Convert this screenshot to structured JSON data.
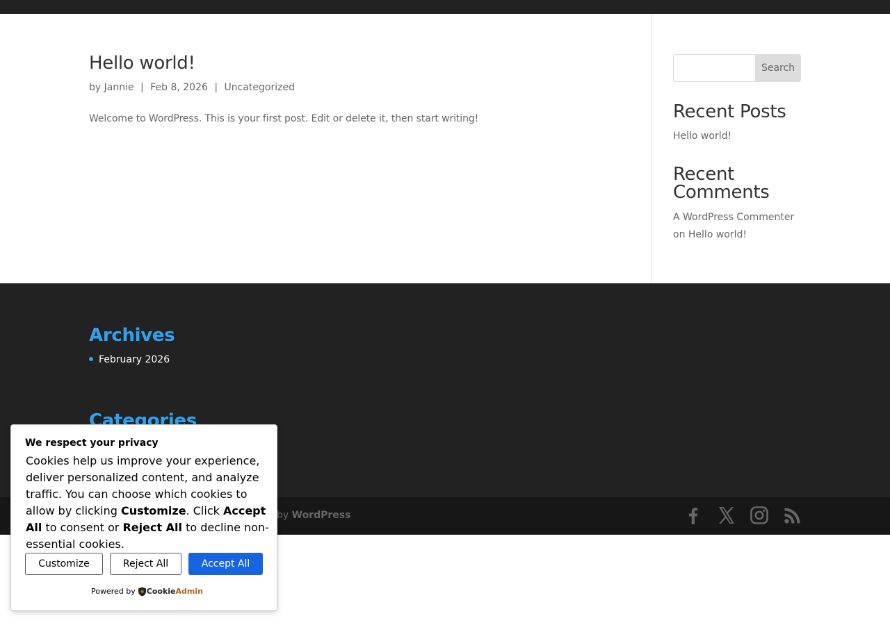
{
  "post": {
    "title": "Hello world!",
    "meta_by": "by",
    "author": "Jannie",
    "sep": "|",
    "date": "Feb 8, 2026",
    "category": "Uncategorized",
    "excerpt": "Welcome to WordPress. This is your first post. Edit or delete it, then start writing!"
  },
  "sidebar": {
    "search_placeholder": "",
    "search_button": "Search",
    "recent_posts_title": "Recent Posts",
    "recent_posts": [
      "Hello world!"
    ],
    "recent_comments_title_line1": "Recent",
    "recent_comments_title_line2": "Comments",
    "comment_author": "A WordPress Commenter",
    "comment_on": "on",
    "comment_post": "Hello world!"
  },
  "footer": {
    "archives_title": "Archives",
    "archives": [
      "February 2026"
    ],
    "categories_title": "Categories",
    "credit_prefix": "by",
    "credit_link": "WordPress",
    "social_icons": [
      "facebook-icon",
      "x-icon",
      "instagram-icon",
      "rss-icon"
    ]
  },
  "cookie_banner": {
    "title": "We respect your privacy",
    "text_1": "Cookies help us improve your experience, deliver personalized content, and analyze traffic. You can choose which cookies to allow by clicking ",
    "bold_customize": "Customize",
    "text_2": ". Click ",
    "bold_accept": "Accept All",
    "text_3": " to consent or ",
    "bold_reject": "Reject All",
    "text_4": " to decline non-essential cookies.",
    "customize_button": "Customize",
    "reject_button": "Reject All",
    "accept_button": "Accept All",
    "powered_by": "Powered by",
    "brand_part1": "Cookie",
    "brand_part2": "Admin"
  },
  "colors": {
    "accent": "#2ea3f2",
    "dark_bg": "#222222",
    "bottom_bar": "#171717",
    "accept_button": "#1664e0"
  }
}
